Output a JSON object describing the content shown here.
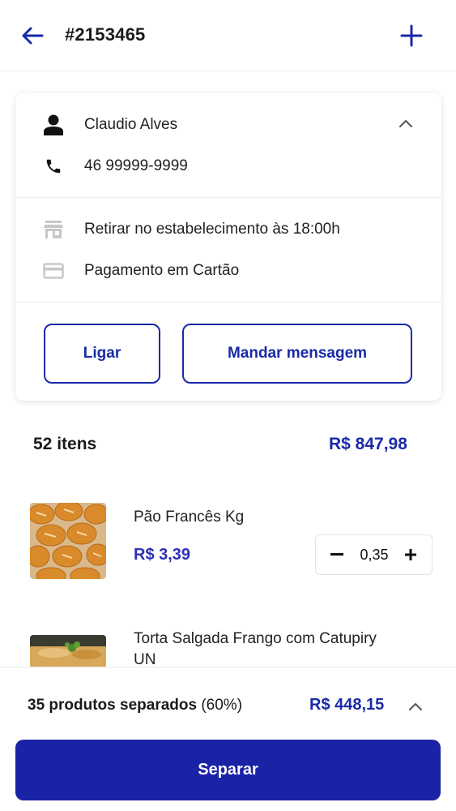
{
  "header": {
    "order_number": "#2153465",
    "back_icon": "arrow-left-icon",
    "add_icon": "plus-icon"
  },
  "customer": {
    "name": "Claudio Alves",
    "phone": "46 99999-9999",
    "delivery": "Retirar no estabelecimento às 18:00h",
    "payment": "Pagamento em Cartão",
    "call_label": "Ligar",
    "message_label": "Mandar mensagem"
  },
  "summary": {
    "items_count": "52 itens",
    "total": "R$ 847,98"
  },
  "products": [
    {
      "name": "Pão Francês Kg",
      "price": "R$ 3,39",
      "quantity": "0,35"
    },
    {
      "name": "Torta Salgada Frango com Catupiry UN"
    }
  ],
  "bottom": {
    "separated_count": "35 produtos separados",
    "separated_percent": "(60%)",
    "separated_total": "R$ 448,15",
    "action_label": "Separar"
  },
  "colors": {
    "primary": "#1a22a6",
    "price": "#2d2fb8",
    "icon_gray": "#c8c8c8"
  }
}
